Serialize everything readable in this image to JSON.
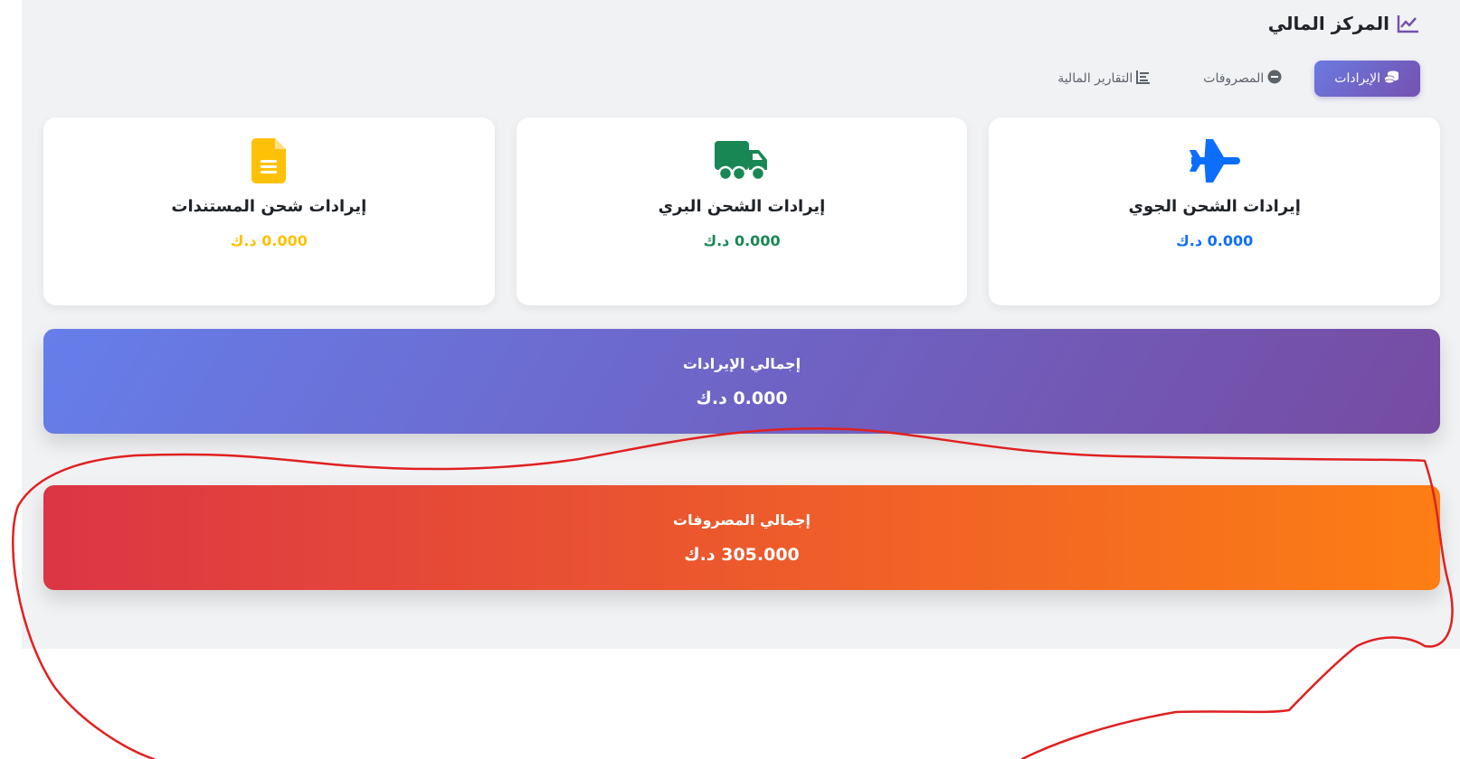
{
  "header": {
    "title": "المركز المالي",
    "title_icon": "chart-line-icon",
    "accent": "#7451b0"
  },
  "tabs": [
    {
      "label": "الإيرادات",
      "icon": "coins-icon",
      "active": true
    },
    {
      "label": "المصروفات",
      "icon": "minus-circle-icon",
      "active": false
    },
    {
      "label": "التقارير المالية",
      "icon": "report-icon",
      "active": false
    }
  ],
  "cards": {
    "air": {
      "label": "إيرادات الشحن الجوي",
      "amount": "0.000 د.ك",
      "icon": "plane-icon",
      "color": "#0d6efd"
    },
    "land": {
      "label": "إيرادات الشحن البري",
      "amount": "0.000 د.ك",
      "icon": "truck-icon",
      "color": "#198754"
    },
    "docs": {
      "label": "إيرادات شحن المستندات",
      "amount": "0.000 د.ك",
      "icon": "document-icon",
      "color": "#ffc107"
    }
  },
  "totals": {
    "revenue": {
      "label": "إجمالي الإيرادات",
      "amount": "0.000 د.ك"
    },
    "expenses": {
      "label": "إجمالي المصروفات",
      "amount": "305.000 د.ك"
    }
  },
  "annotation_color": "#e02020"
}
